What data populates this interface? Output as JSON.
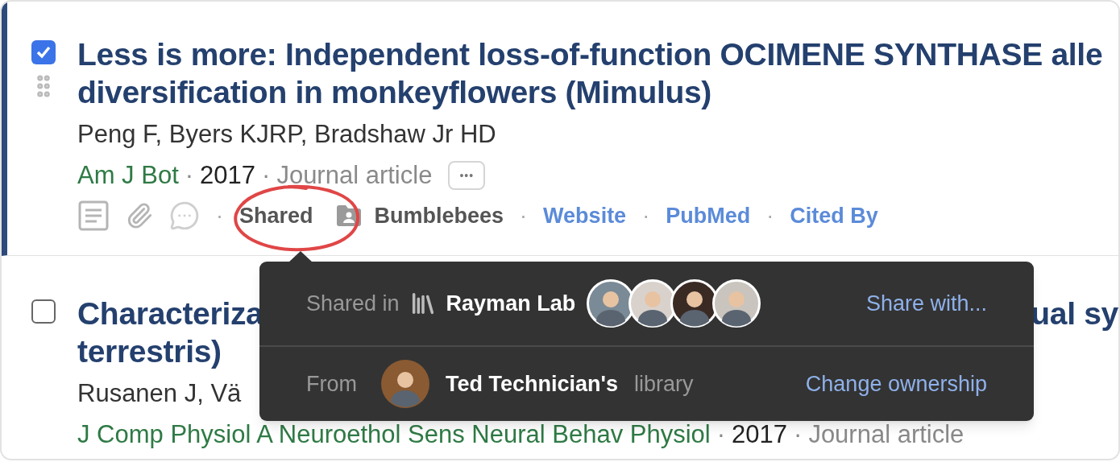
{
  "articles": [
    {
      "selected": true,
      "title_lines": [
        [
          "Less is more: Independent loss-of-function OCIMENE SYNTHASE alle"
        ],
        [
          "diversification in monkeyflowers (Mimulus)"
        ]
      ],
      "authors": "Peng F, Byers KJRP, Bradshaw Jr HD",
      "meta": [
        {
          "kind": "journal",
          "text": "Am J Bot"
        },
        {
          "kind": "separator",
          "text": "·"
        },
        {
          "kind": "year",
          "text": "2017"
        },
        {
          "kind": "separator",
          "text": "·"
        },
        {
          "kind": "type",
          "text": "Journal article"
        }
      ],
      "more_label": "•••",
      "actions": [
        {
          "kind": "notes"
        },
        {
          "kind": "attachments"
        },
        {
          "kind": "comments"
        },
        {
          "kind": "separator",
          "text": "·"
        },
        {
          "kind": "shared",
          "text": "Shared"
        },
        {
          "kind": "folder",
          "text": "Bumblebees"
        },
        {
          "kind": "separator",
          "text": "·"
        },
        {
          "kind": "link",
          "text": "Website"
        },
        {
          "kind": "separator",
          "text": "·"
        },
        {
          "kind": "link",
          "text": "PubMed"
        },
        {
          "kind": "separator",
          "text": "·"
        },
        {
          "kind": "link",
          "text": "Cited By"
        }
      ]
    },
    {
      "selected": false,
      "title_lines": [
        [
          "Characteriza",
          "ual sy"
        ],
        [
          "terrestris)"
        ]
      ],
      "authors": "Rusanen J, Vä",
      "meta": [
        {
          "kind": "journal",
          "text": "J Comp Physiol A Neuroethol Sens Neural Behav Physiol"
        },
        {
          "kind": "separator",
          "text": "·"
        },
        {
          "kind": "year",
          "text": "2017"
        },
        {
          "kind": "separator",
          "text": "·"
        },
        {
          "kind": "type",
          "text": "Journal article"
        }
      ]
    }
  ],
  "share_popover": {
    "shared_in_label": "Shared in",
    "library_name": "Rayman Lab",
    "members": [
      {
        "color": "#7a8a96"
      },
      {
        "color": "#d9d2cc"
      },
      {
        "color": "#3a2a24"
      },
      {
        "color": "#c9c4bd"
      }
    ],
    "share_link": "Share with...",
    "from_label": "From",
    "owner_avatar": {
      "color": "#8a5a32"
    },
    "owner": "Ted Technician's",
    "owner_suffix": "library",
    "change_link": "Change ownership"
  }
}
